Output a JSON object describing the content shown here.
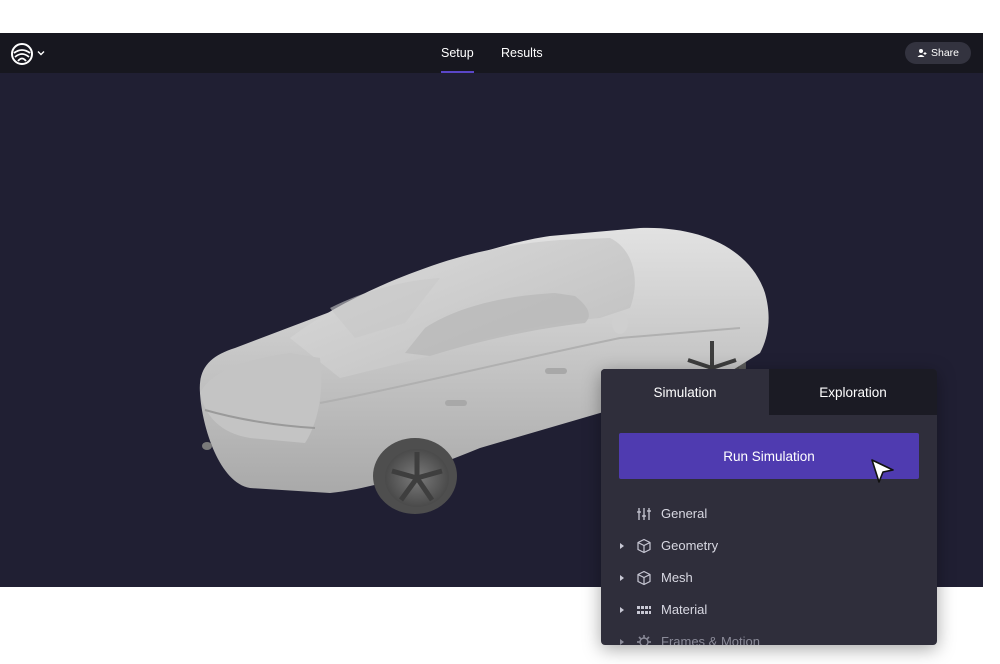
{
  "topbar": {
    "nav_tabs": [
      {
        "label": "Setup",
        "active": true
      },
      {
        "label": "Results",
        "active": false
      }
    ],
    "share_label": "Share"
  },
  "panel": {
    "tabs": [
      {
        "label": "Simulation",
        "active": true
      },
      {
        "label": "Exploration",
        "active": false
      }
    ],
    "run_button_label": "Run Simulation",
    "items": [
      {
        "label": "General",
        "icon": "sliders-icon",
        "expandable": false
      },
      {
        "label": "Geometry",
        "icon": "cube-icon",
        "expandable": true
      },
      {
        "label": "Mesh",
        "icon": "cube-icon",
        "expandable": true
      },
      {
        "label": "Material",
        "icon": "grid-icon",
        "expandable": true
      },
      {
        "label": "Frames & Motion",
        "icon": "gear-icon",
        "expandable": true
      }
    ]
  },
  "colors": {
    "viewport_bg": "#201f33",
    "topbar_bg": "#17171f",
    "accent": "#4f3bb0",
    "panel_bg": "#2f2e3b"
  }
}
